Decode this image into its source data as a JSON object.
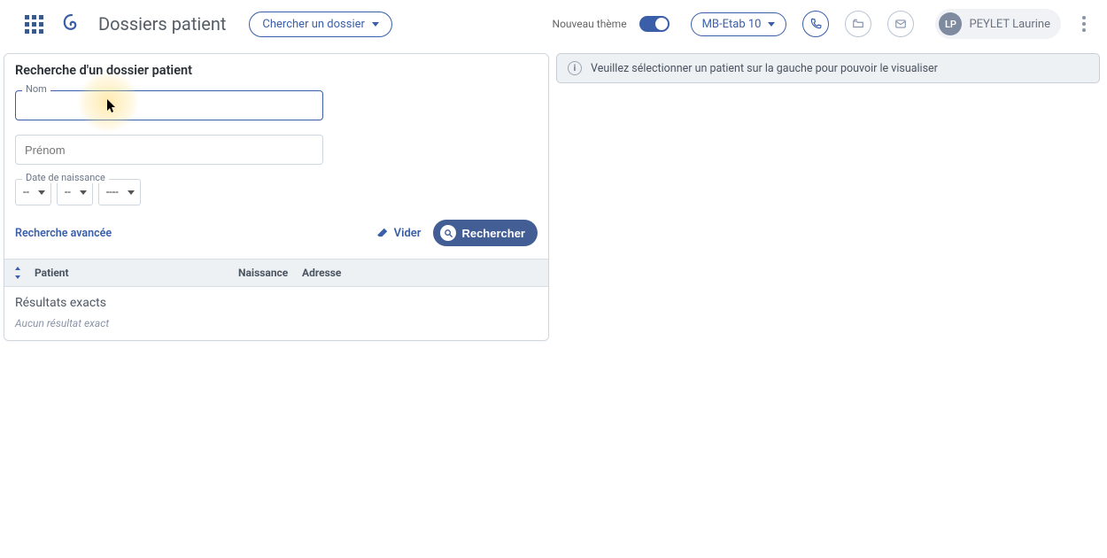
{
  "header": {
    "page_title": "Dossiers patient",
    "search_dossier_label": "Chercher un dossier",
    "theme_label": "Nouveau thème",
    "theme_on": true,
    "establishment": "MB-Etab 10",
    "user": {
      "initials": "LP",
      "name": "PEYLET Laurine"
    }
  },
  "search": {
    "title": "Recherche d'un dossier patient",
    "name_label": "Nom",
    "name_value": "",
    "firstname_placeholder": "Prénom",
    "firstname_value": "",
    "dob_label": "Date de naissance",
    "dob_day": "--",
    "dob_month": "--",
    "dob_year": "----",
    "advanced_label": "Recherche avancée",
    "clear_label": "Vider",
    "submit_label": "Rechercher"
  },
  "table": {
    "columns": {
      "patient": "Patient",
      "birth": "Naissance",
      "address": "Adresse"
    }
  },
  "results": {
    "exact_title": "Résultats exacts",
    "none_text": "Aucun résultat exact"
  },
  "right": {
    "info_text": "Veuillez sélectionner un patient sur la gauche pour pouvoir le visualiser"
  }
}
